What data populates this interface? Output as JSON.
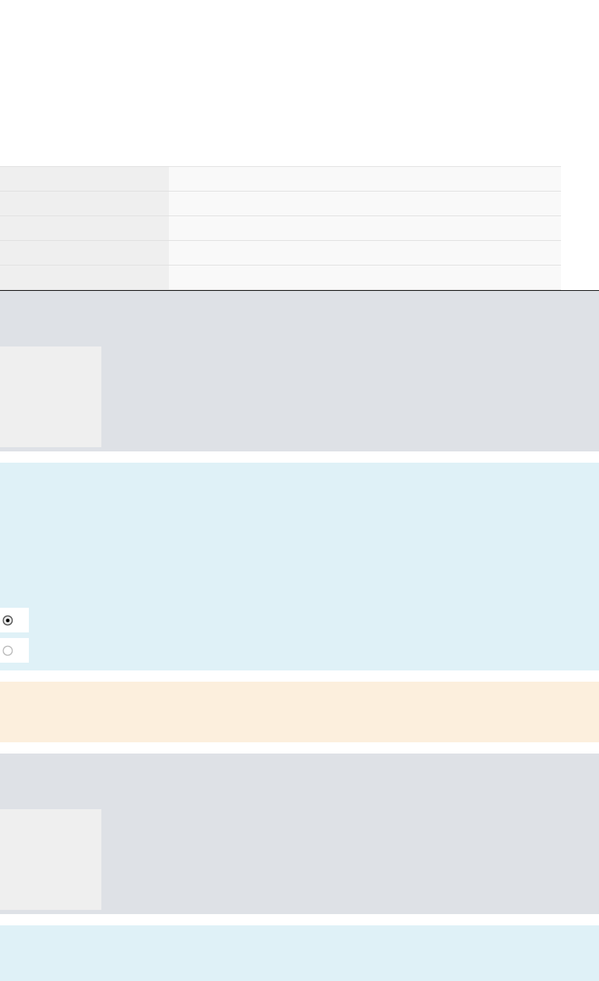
{
  "table": {
    "rows": [
      {},
      {},
      {},
      {},
      {}
    ]
  },
  "sections": [
    {
      "kind": "gray"
    },
    {
      "kind": "info",
      "radios": [
        {
          "selected": true
        },
        {
          "selected": false
        }
      ]
    },
    {
      "kind": "warning"
    },
    {
      "kind": "gray"
    },
    {
      "kind": "info"
    }
  ]
}
